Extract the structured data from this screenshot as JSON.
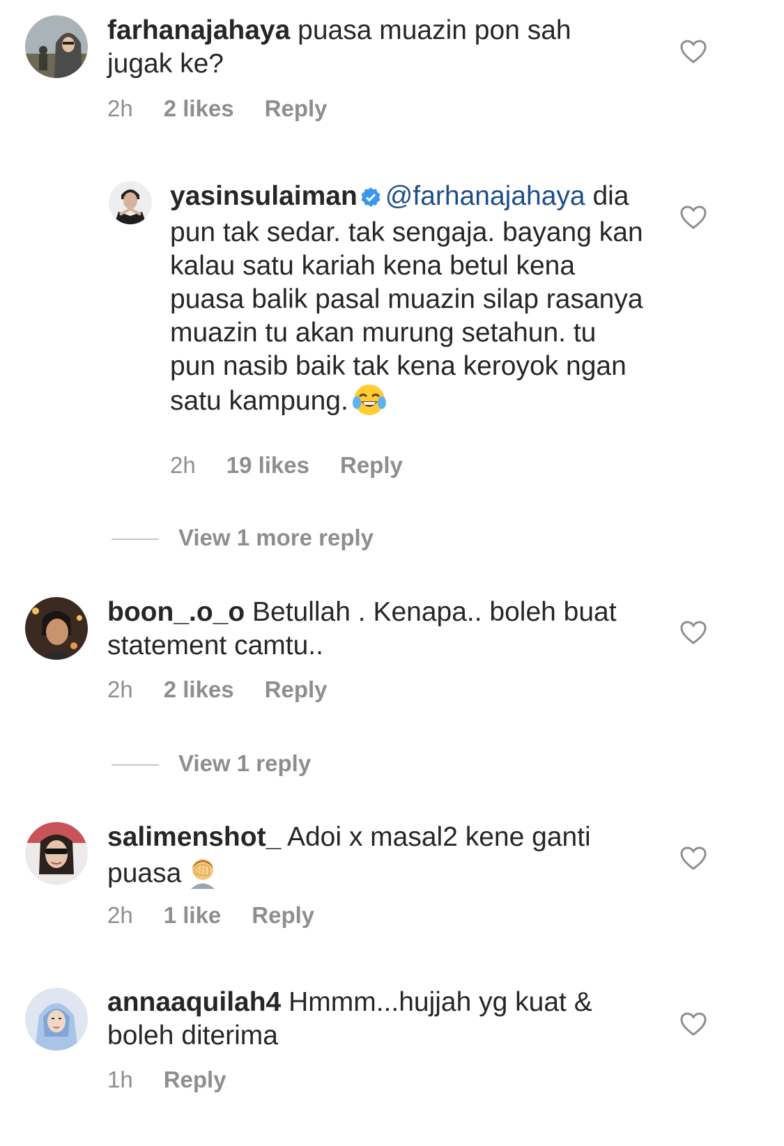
{
  "comments": [
    {
      "username": "farhanajahaya",
      "text": "puasa muazin pon sah jugak ke?",
      "time": "2h",
      "likes": "2 likes",
      "reply": "Reply"
    },
    {
      "username": "yasinsulaiman",
      "verified": true,
      "mention": "@farhanajahaya",
      "text": "dia pun tak sedar. tak sengaja. bayang kan kalau satu kariah kena betul kena puasa balik pasal muazin silap rasanya muazin tu akan murung setahun. tu pun nasib baik tak kena keroyok ngan satu kampung.",
      "emoji": "face-with-tears-of-joy-emoji",
      "time": "2h",
      "likes": "19 likes",
      "reply": "Reply"
    },
    {
      "username": "boon_.o_o",
      "text": "Betullah . Kenapa.. boleh buat statement camtu..",
      "time": "2h",
      "likes": "2 likes",
      "reply": "Reply"
    },
    {
      "username": "salimenshot_",
      "text": "Adoi x masal2 kene ganti puasa",
      "emoji": "facepalm-emoji",
      "time": "2h",
      "likes": "1 like",
      "reply": "Reply"
    },
    {
      "username": "annaaquilah4",
      "text": "Hmmm...hujjah yg kuat & boleh diterima",
      "time": "1h",
      "reply": "Reply"
    }
  ],
  "view_more_replies": {
    "first": "View 1 more reply",
    "second": "View 1 reply"
  },
  "colors": {
    "text": "#262626",
    "meta": "#8e8e8e",
    "mention": "#1d4e89",
    "verified": "#3897f0"
  }
}
